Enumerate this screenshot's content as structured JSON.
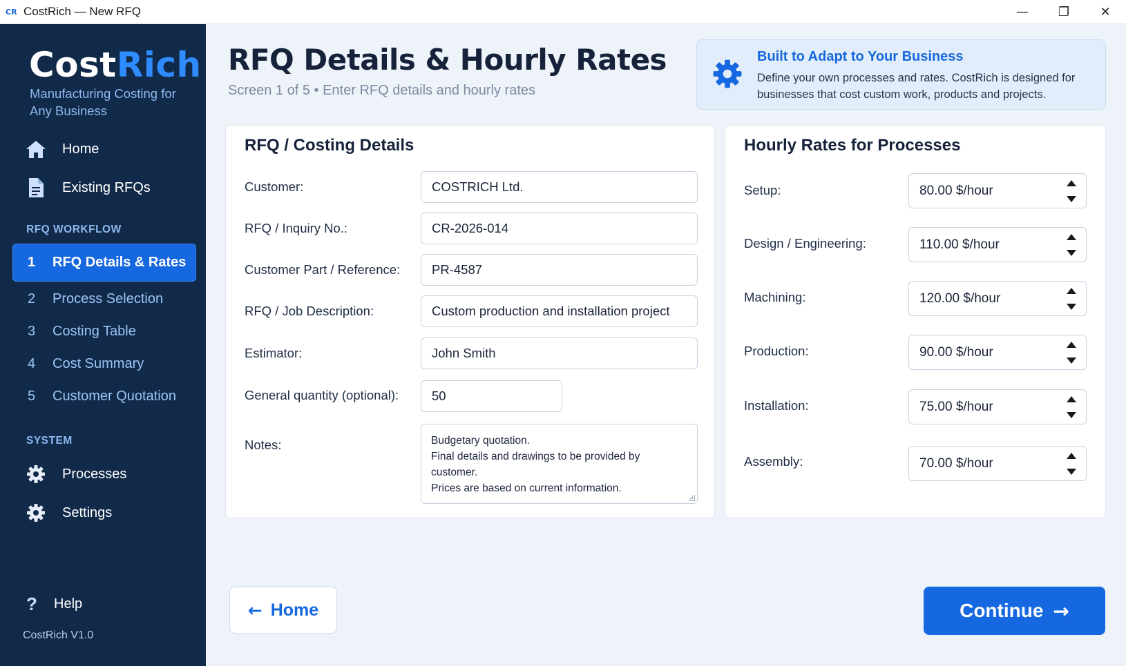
{
  "window": {
    "app_logo": "CR",
    "title": "CostRich — New RFQ",
    "controls": {
      "minimize": "—",
      "maximize": "❐",
      "close": "✕"
    }
  },
  "sidebar": {
    "brand_part1": "Cost",
    "brand_part2": "Rich",
    "tagline": "Manufacturing Costing for Any Business",
    "nav": [
      {
        "label": "Home",
        "icon": "home-icon"
      },
      {
        "label": "Existing RFQs",
        "icon": "document-icon"
      }
    ],
    "workflow_heading": "RFQ WORKFLOW",
    "steps": [
      {
        "num": "1",
        "label": "RFQ Details & Rates",
        "active": true
      },
      {
        "num": "2",
        "label": "Process Selection",
        "active": false
      },
      {
        "num": "3",
        "label": "Costing Table",
        "active": false
      },
      {
        "num": "4",
        "label": "Cost Summary",
        "active": false
      },
      {
        "num": "5",
        "label": "Customer Quotation",
        "active": false
      }
    ],
    "system_heading": "SYSTEM",
    "system_items": [
      {
        "label": "Processes",
        "icon": "gear-icon"
      },
      {
        "label": "Settings",
        "icon": "gear-icon"
      }
    ],
    "help_icon": "?",
    "help_label": "Help",
    "version": "CostRich  V1.0"
  },
  "header": {
    "title": "RFQ Details & Hourly Rates",
    "subtitle": "Screen 1 of 5  •  Enter RFQ details and hourly rates"
  },
  "info_card": {
    "icon": "gear-icon",
    "title": "Built to Adapt to Your Business",
    "text": "Define your own processes and rates. CostRich is designed for businesses that cost custom work, products and projects."
  },
  "rfq_details": {
    "title": "RFQ / Costing Details",
    "fields": [
      {
        "label": "Customer:",
        "value": "COSTRICH Ltd."
      },
      {
        "label": "RFQ / Inquiry No.:",
        "value": "CR-2026-014"
      },
      {
        "label": "Customer Part / Reference:",
        "value": "PR-4587"
      },
      {
        "label": "RFQ / Job Description:",
        "value": "Custom production and installation project"
      },
      {
        "label": "Estimator:",
        "value": "John Smith"
      },
      {
        "label": "General quantity (optional):",
        "value": "50"
      }
    ],
    "notes_label": "Notes:",
    "notes_lines": [
      "Budgetary quotation.",
      "Final details and drawings to be provided by customer.",
      "Prices are based on current information."
    ]
  },
  "hourly_rates": {
    "title": "Hourly Rates for Processes",
    "rates": [
      {
        "label": "Setup:",
        "value": "80.00 $/hour"
      },
      {
        "label": "Design / Engineering:",
        "value": "110.00 $/hour"
      },
      {
        "label": "Machining:",
        "value": "120.00 $/hour"
      },
      {
        "label": "Production:",
        "value": "90.00 $/hour"
      },
      {
        "label": "Installation:",
        "value": "75.00 $/hour"
      },
      {
        "label": "Assembly:",
        "value": "70.00 $/hour"
      }
    ]
  },
  "footer": {
    "home_arrow": "←",
    "home_label": "Home",
    "continue_label": "Continue",
    "continue_arrow": "→"
  },
  "colors": {
    "sidebar_bg": "#112a4a",
    "accent": "#1668e0",
    "brand_accent": "#2f8cff",
    "page_bg": "#eef3fa"
  }
}
